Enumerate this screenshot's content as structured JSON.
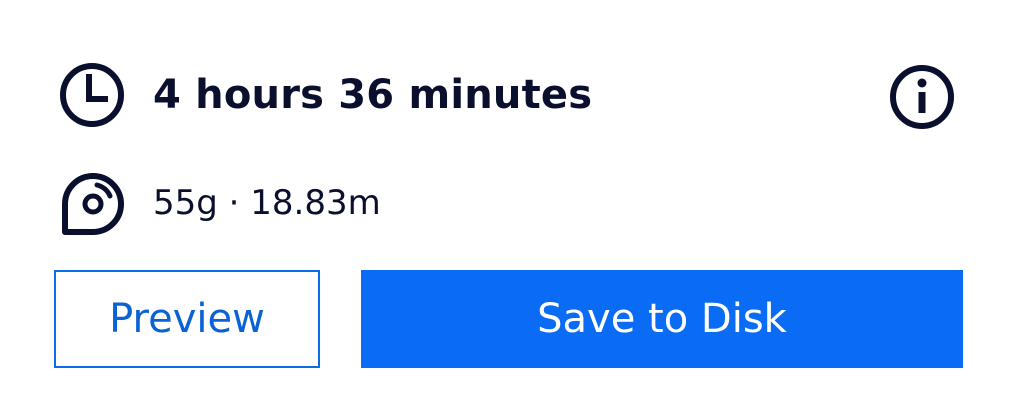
{
  "print_info": {
    "duration": "4 hours 36 minutes",
    "material": "55g · 18.83m"
  },
  "buttons": {
    "preview_label": "Preview",
    "save_label": "Save to Disk"
  },
  "icons": {
    "duration": "clock-icon",
    "material": "filament-spool-icon",
    "info": "info-icon"
  },
  "colors": {
    "text": "#0b0f2e",
    "accent": "#0a6cf5",
    "preview_text": "#0a62d4"
  }
}
